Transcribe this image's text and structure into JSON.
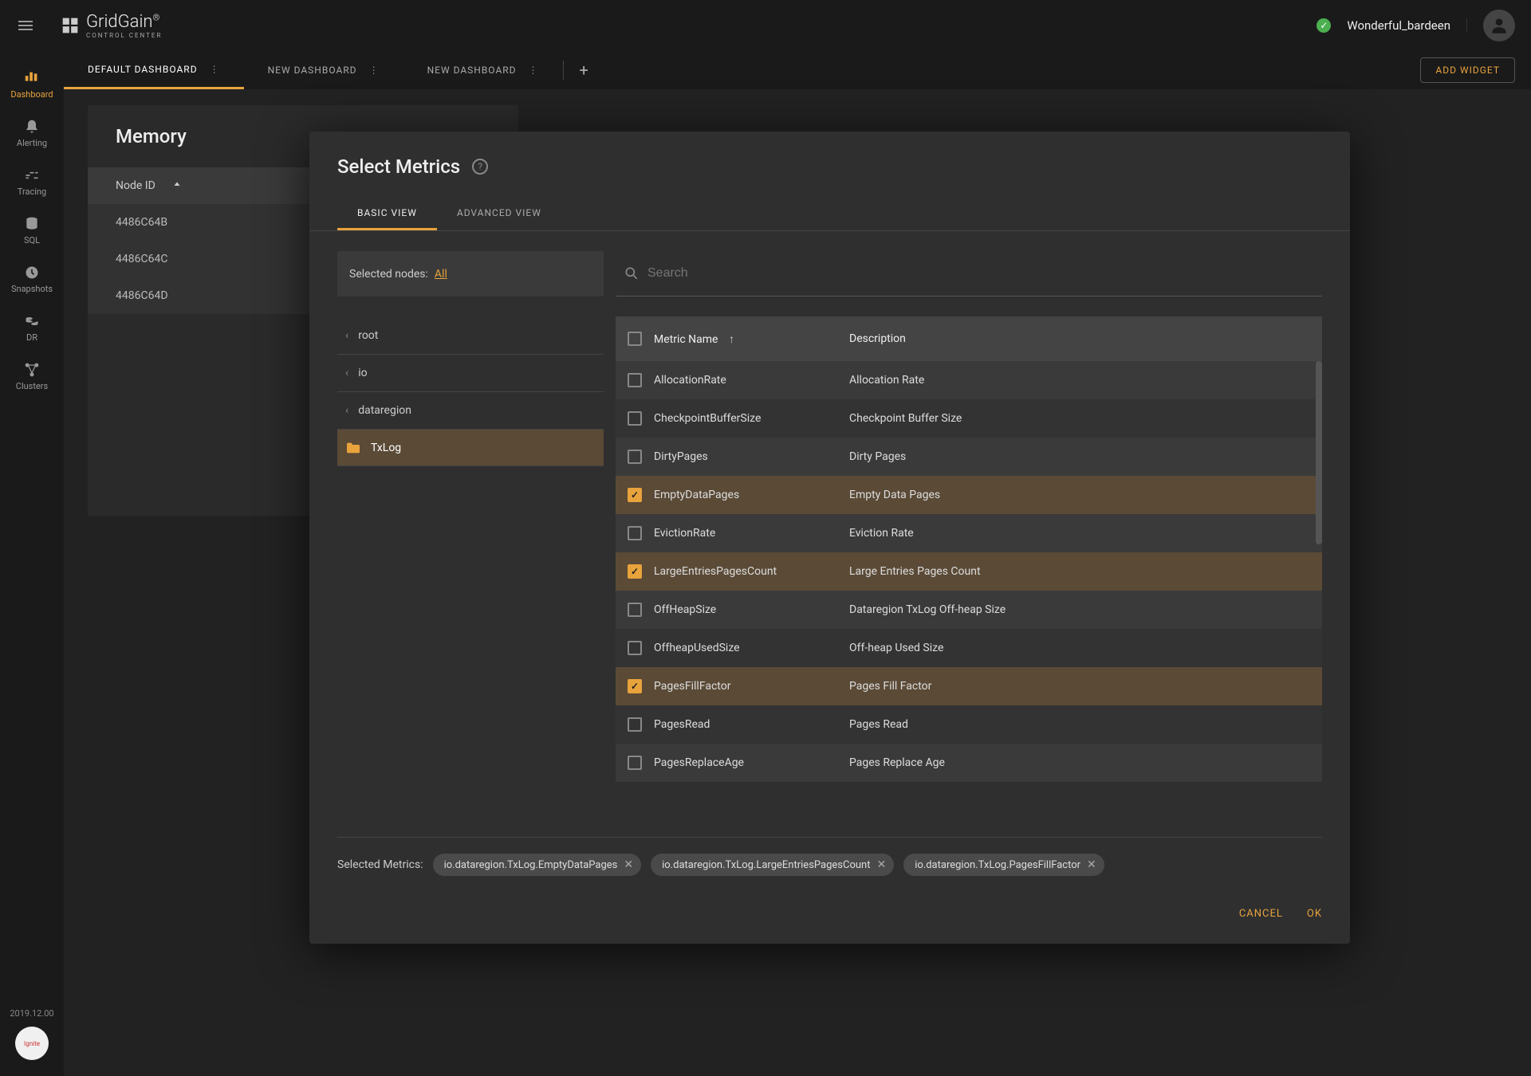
{
  "topbar": {
    "logo": "GridGain",
    "logoSub": "CONTROL CENTER",
    "username": "Wonderful_bardeen"
  },
  "sidebar": {
    "items": [
      {
        "label": "Dashboard"
      },
      {
        "label": "Alerting"
      },
      {
        "label": "Tracing"
      },
      {
        "label": "SQL"
      },
      {
        "label": "Snapshots"
      },
      {
        "label": "DR"
      },
      {
        "label": "Clusters"
      }
    ],
    "version": "2019.12.00"
  },
  "tabs": {
    "items": [
      {
        "label": "DEFAULT DASHBOARD"
      },
      {
        "label": "NEW DASHBOARD"
      },
      {
        "label": "NEW DASHBOARD"
      }
    ],
    "addWidget": "ADD WIDGET"
  },
  "widget": {
    "title": "Memory",
    "header": "Node ID",
    "rows": [
      "4486C64B",
      "4486C64C",
      "4486C64D"
    ]
  },
  "dialog": {
    "title": "Select Metrics",
    "viewTabs": {
      "basic": "BASIC VIEW",
      "advanced": "ADVANCED VIEW"
    },
    "selectedNodes": {
      "label": "Selected nodes:",
      "link": "All"
    },
    "searchPlaceholder": "Search",
    "tree": [
      {
        "label": "root",
        "type": "crumb"
      },
      {
        "label": "io",
        "type": "crumb"
      },
      {
        "label": "dataregion",
        "type": "crumb"
      },
      {
        "label": "TxLog",
        "type": "folder"
      }
    ],
    "columns": {
      "name": "Metric Name",
      "desc": "Description"
    },
    "metrics": [
      {
        "name": "AllocationRate",
        "desc": "Allocation Rate",
        "checked": false
      },
      {
        "name": "CheckpointBufferSize",
        "desc": "Checkpoint Buffer Size",
        "checked": false
      },
      {
        "name": "DirtyPages",
        "desc": "Dirty Pages",
        "checked": false
      },
      {
        "name": "EmptyDataPages",
        "desc": "Empty Data Pages",
        "checked": true
      },
      {
        "name": "EvictionRate",
        "desc": "Eviction Rate",
        "checked": false
      },
      {
        "name": "LargeEntriesPagesCount",
        "desc": "Large Entries Pages Count",
        "checked": true
      },
      {
        "name": "OffHeapSize",
        "desc": "Dataregion TxLog Off-heap Size",
        "checked": false
      },
      {
        "name": "OffheapUsedSize",
        "desc": "Off-heap Used Size",
        "checked": false
      },
      {
        "name": "PagesFillFactor",
        "desc": "Pages Fill Factor",
        "checked": true
      },
      {
        "name": "PagesRead",
        "desc": "Pages Read",
        "checked": false
      },
      {
        "name": "PagesReplaceAge",
        "desc": "Pages Replace Age",
        "checked": false
      }
    ],
    "selectedMetricsLabel": "Selected Metrics:",
    "selectedChips": [
      "io.dataregion.TxLog.EmptyDataPages",
      "io.dataregion.TxLog.LargeEntriesPagesCount",
      "io.dataregion.TxLog.PagesFillFactor"
    ],
    "footer": {
      "cancel": "CANCEL",
      "ok": "OK"
    }
  }
}
